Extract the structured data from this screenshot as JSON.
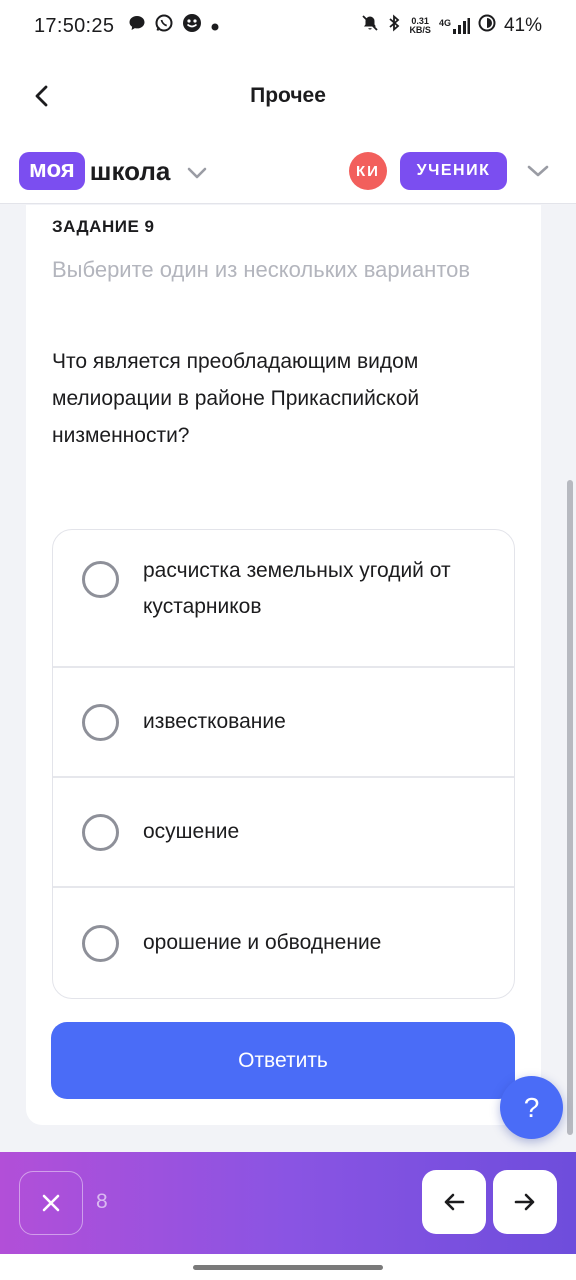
{
  "status_bar": {
    "time": "17:50:25",
    "net_speed_value": "0.31",
    "net_speed_unit": "KB/S",
    "network_type": "4G",
    "battery": "41%"
  },
  "header": {
    "title": "Прочее"
  },
  "school_bar": {
    "logo_part1": "моя",
    "logo_part2": "школа",
    "avatar_initials": "КИ",
    "role": "УЧЕНИК"
  },
  "task": {
    "number_label": "ЗАДАНИЕ 9",
    "hint": "Выберите один из нескольких вариантов",
    "question": "Что является преобладающим видом мелиорации в районе Прикаспийской низменности?",
    "options": [
      "расчистка земельных угодий от кустарников",
      "известкование",
      "осушение",
      "орошение и обводнение"
    ],
    "answer_button": "Ответить"
  },
  "help_button": "?",
  "bottom_bar": {
    "counter": "8"
  },
  "colors": {
    "brand_purple": "#7b4ef0",
    "primary_blue": "#4a6cf7",
    "avatar_red": "#f25f5c"
  }
}
